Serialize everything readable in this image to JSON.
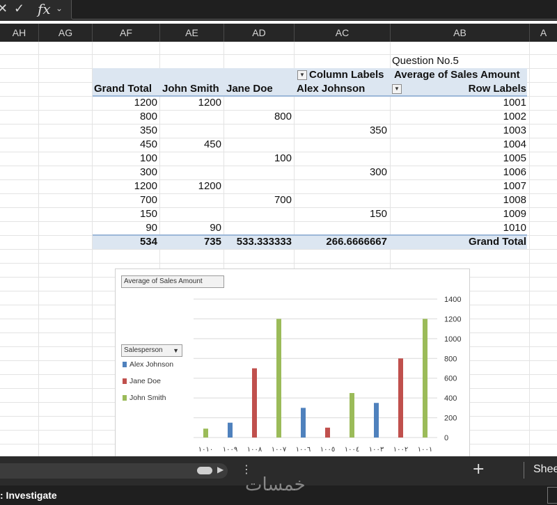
{
  "formula_bar": {
    "cancel_symbol": "✕",
    "enter_symbol": "✓",
    "function_symbol": "fx",
    "dropdown_symbol": "⌄"
  },
  "columns": [
    "AH",
    "AG",
    "AF",
    "AE",
    "AD",
    "AC",
    "AB",
    "A"
  ],
  "title_cell": "Question No.5",
  "pivot": {
    "column_labels": "Column Labels",
    "value_field": "Average of Sales Amount",
    "row_labels": "Row Labels",
    "headers": [
      "Grand Total",
      "John Smith",
      "Jane Doe",
      "Alex Johnson"
    ],
    "rows": [
      {
        "label": "1001",
        "alex": "",
        "jane": "",
        "john": "1200",
        "total": "1200"
      },
      {
        "label": "1002",
        "alex": "",
        "jane": "800",
        "john": "",
        "total": "800"
      },
      {
        "label": "1003",
        "alex": "350",
        "jane": "",
        "john": "",
        "total": "350"
      },
      {
        "label": "1004",
        "alex": "",
        "jane": "",
        "john": "450",
        "total": "450"
      },
      {
        "label": "1005",
        "alex": "",
        "jane": "100",
        "john": "",
        "total": "100"
      },
      {
        "label": "1006",
        "alex": "300",
        "jane": "",
        "john": "",
        "total": "300"
      },
      {
        "label": "1007",
        "alex": "",
        "jane": "",
        "john": "1200",
        "total": "1200"
      },
      {
        "label": "1008",
        "alex": "",
        "jane": "700",
        "john": "",
        "total": "700"
      },
      {
        "label": "1009",
        "alex": "150",
        "jane": "",
        "john": "",
        "total": "150"
      },
      {
        "label": "1010",
        "alex": "",
        "jane": "",
        "john": "90",
        "total": "90"
      }
    ],
    "grand_total": {
      "label": "Grand Total",
      "alex": "266.6666667",
      "jane": "533.333333",
      "john": "735",
      "total": "534"
    }
  },
  "chart_data": {
    "type": "bar",
    "field_button": "Average of Sales Amount",
    "legend_field": "Salesperson",
    "legend_arrow": "▼",
    "categories": [
      "١٠١٠",
      "١٠٠٩",
      "١٠٠٨",
      "١٠٠٧",
      "١٠٠٦",
      "١٠٠٥",
      "١٠٠٤",
      "١٠٠٣",
      "١٠٠٢",
      "١٠٠١"
    ],
    "series": [
      {
        "name": "Alex Johnson",
        "color": "#4f81bd",
        "values": [
          null,
          150,
          null,
          null,
          300,
          null,
          null,
          350,
          null,
          null
        ]
      },
      {
        "name": "Jane Doe",
        "color": "#c0504d",
        "values": [
          null,
          null,
          700,
          null,
          null,
          100,
          null,
          null,
          800,
          null
        ]
      },
      {
        "name": "John Smith",
        "color": "#9bbb59",
        "values": [
          90,
          null,
          null,
          1200,
          null,
          null,
          450,
          null,
          null,
          1200
        ]
      }
    ],
    "yticks": [
      "0",
      "200",
      "400",
      "600",
      "800",
      "1000",
      "1200",
      "1400"
    ],
    "ylim": [
      0,
      1400
    ],
    "y_axis_position": "right",
    "grid": true
  },
  "sheet_bar": {
    "add_symbol": "+",
    "more_symbol": "⋮",
    "scroll_arrow": "▶",
    "sheet_tab": "Shee"
  },
  "status": {
    "text": ": Investigate"
  },
  "watermark": "خمسات"
}
